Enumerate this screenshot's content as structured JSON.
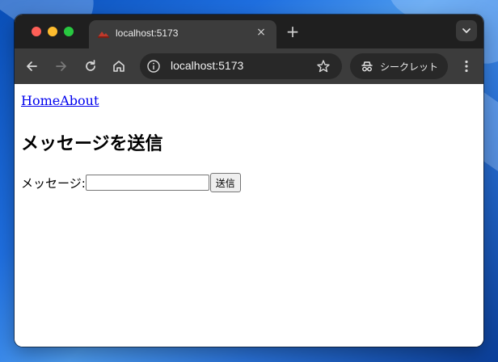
{
  "tab": {
    "title": "localhost:5173",
    "close_glyph": "×",
    "new_tab_glyph": "+"
  },
  "toolbar": {
    "back_icon": "arrow-left-icon",
    "forward_icon": "arrow-right-icon",
    "reload_icon": "reload-icon",
    "home_icon": "home-icon",
    "url": "localhost:5173",
    "incognito_label": "シークレット"
  },
  "page": {
    "nav": [
      {
        "label": "Home"
      },
      {
        "label": "About"
      }
    ],
    "heading": "メッセージを送信",
    "message_label": "メッセージ:",
    "message_value": "",
    "send_button": "送信"
  },
  "colors": {
    "link": "#0000ee",
    "tab_bar": "#1f1f1f",
    "toolbar": "#3c3c3c",
    "close_light": "#fe5f57",
    "minimize_light": "#febc2e",
    "maximize_light": "#28c840"
  }
}
